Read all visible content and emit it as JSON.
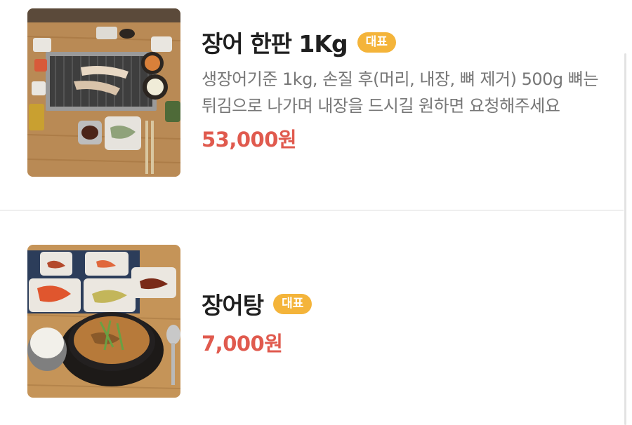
{
  "menu": {
    "items": [
      {
        "title": "장어 한판 1Kg",
        "badge": "대표",
        "description": "생장어기준 1kg, 손질 후(머리, 내장, 뼈 제거) 500g 뼈는 튀김으로 나가며 내장을 드시길 원하면 요청해주세요",
        "price": "53,000원",
        "image": "grilled-eel-table-photo"
      },
      {
        "title": "장어탕",
        "badge": "대표",
        "price": "7,000원",
        "image": "eel-soup-set-photo"
      }
    ]
  },
  "colors": {
    "badge": "#f4b43a",
    "price": "#e05a4e",
    "description": "#777777",
    "title": "#1f1f1f"
  }
}
